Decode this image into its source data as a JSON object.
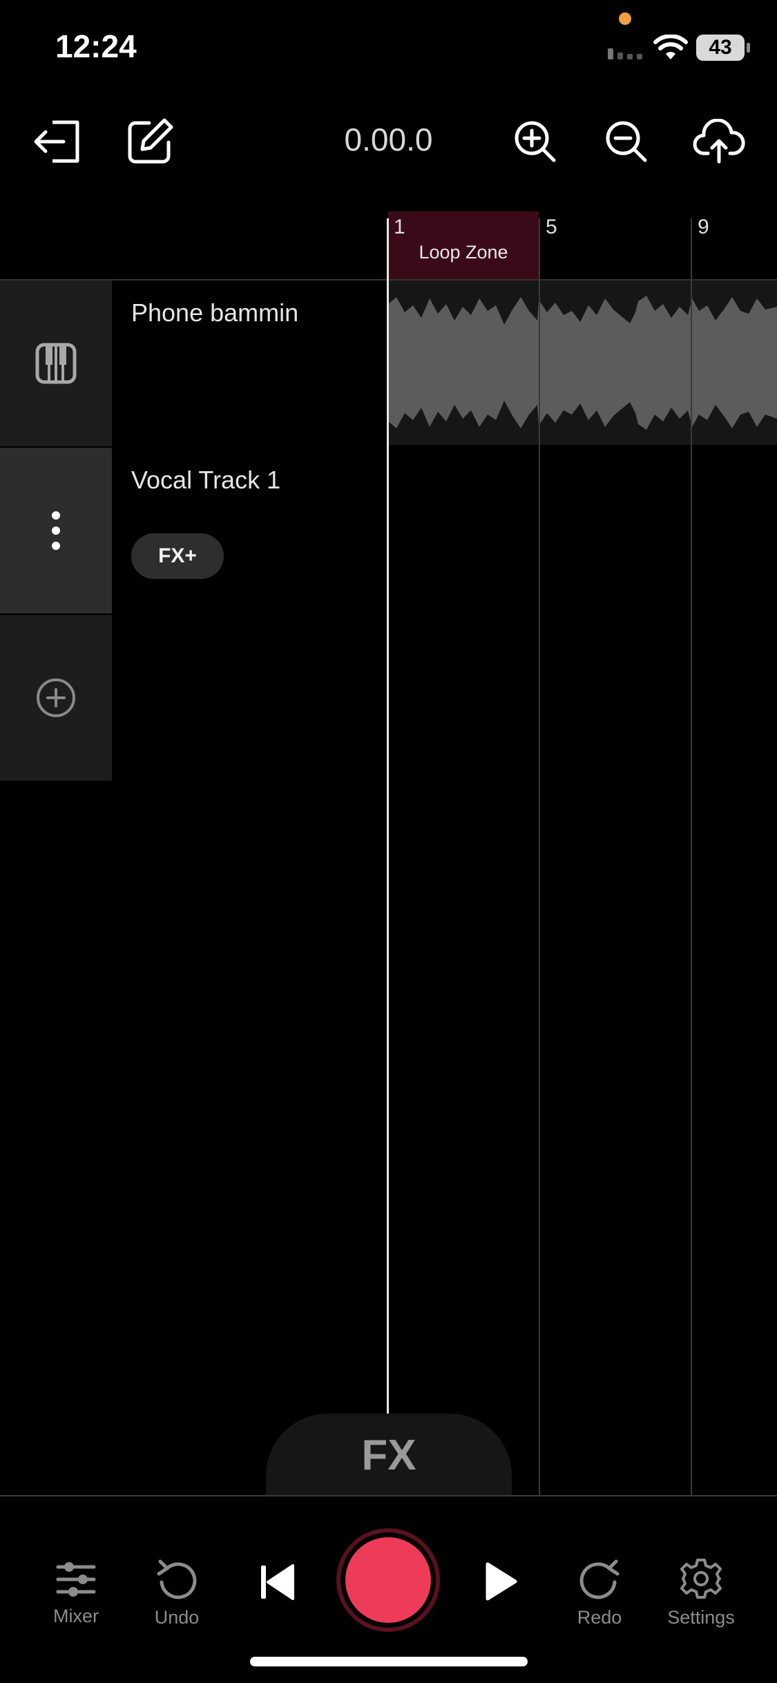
{
  "status_bar": {
    "time": "12:24",
    "battery": "43"
  },
  "toolbar": {
    "position": "0.00.0"
  },
  "ruler": {
    "loop_zone_label": "Loop Zone",
    "bars": [
      "1",
      "5",
      "9"
    ]
  },
  "tracks": [
    {
      "name": "Phone bammin",
      "icon": "piano-icon"
    },
    {
      "name": "Vocal Track 1",
      "icon": "more-vertical-icon",
      "fx_label": "FX+"
    }
  ],
  "fx_tab": {
    "label": "FX"
  },
  "bottom_bar": {
    "mixer": "Mixer",
    "undo": "Undo",
    "redo": "Redo",
    "settings": "Settings"
  },
  "colors": {
    "record": "#ef3b5a",
    "loop_zone": "#3b0a18",
    "background": "#000000"
  }
}
